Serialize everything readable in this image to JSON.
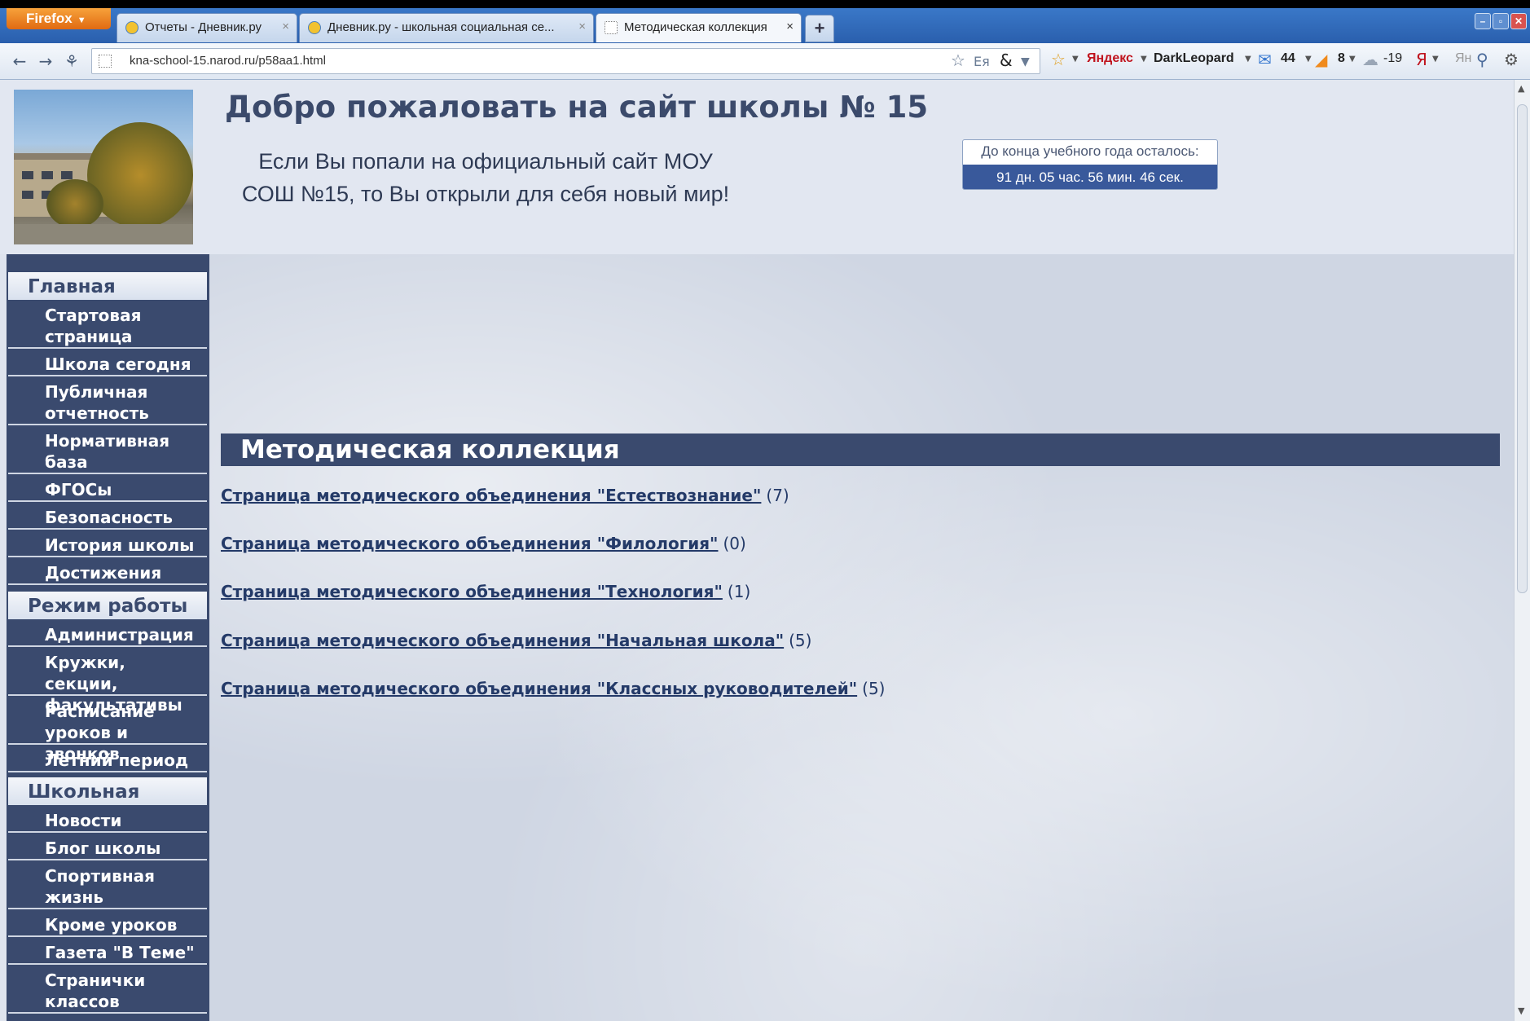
{
  "browser": {
    "menu_label": "Firefox",
    "tabs": [
      {
        "label": "Отчеты - Дневник.ру"
      },
      {
        "label": "Дневник.ру - школьная социальная се..."
      },
      {
        "label": "Методическая коллекция"
      }
    ],
    "url": "kna-school-15.narod.ru/p58aa1.html",
    "toolbar": {
      "yandex_label": "Яндекс",
      "user_label": "DarkLeopard",
      "mail_count": "44",
      "rss_count": "8",
      "weather": "-19",
      "search_hint": "Ян"
    }
  },
  "header": {
    "title": "Добро пожаловать на сайт школы № 15",
    "intro_line1": "Если Вы попали на официальный сайт МОУ",
    "intro_line2": "СОШ №15, то Вы открыли для себя новый мир!",
    "countdown_label": "До конца учебного года осталось:",
    "countdown_value": "91 дн. 05 час. 56 мин. 46 сек."
  },
  "sidebar": {
    "sections": [
      {
        "title": "Главная",
        "items": [
          "Стартовая страница",
          "Школа сегодня",
          "Публичная отчетность",
          "Нормативная база",
          "ФГОСы",
          "Безопасность",
          "История школы",
          "Достижения"
        ]
      },
      {
        "title": "Режим работы",
        "items": [
          "Администрация",
          "Кружки, секции, факультативы",
          "Расписание уроков и звонков",
          "Летний период"
        ]
      },
      {
        "title": "Школьная жизнь",
        "items": [
          "Новости",
          "Блог школы",
          "Спортивная жизнь",
          "Кроме уроков",
          "Газета \"В Теме\"",
          "Странички классов"
        ]
      }
    ]
  },
  "main": {
    "section_title": "Методическая коллекция",
    "links": [
      {
        "label": "Страница методического объединения \"Естествознание\"",
        "count": "(7)"
      },
      {
        "label": "Страница методического объединения \"Филология\"",
        "count": "(0)"
      },
      {
        "label": "Страница методического объединения \"Технология\"",
        "count": "(1)"
      },
      {
        "label": "Страница методического объединения \"Начальная школа\"",
        "count": "(5)"
      },
      {
        "label": "Страница методического объединения \"Классных руководителей\"",
        "count": "(5)"
      }
    ]
  },
  "colors": {
    "accent": "#3a4a6e",
    "link": "#243a68",
    "firefox_button": "#e06a12",
    "countdown_bg": "#39599b"
  }
}
